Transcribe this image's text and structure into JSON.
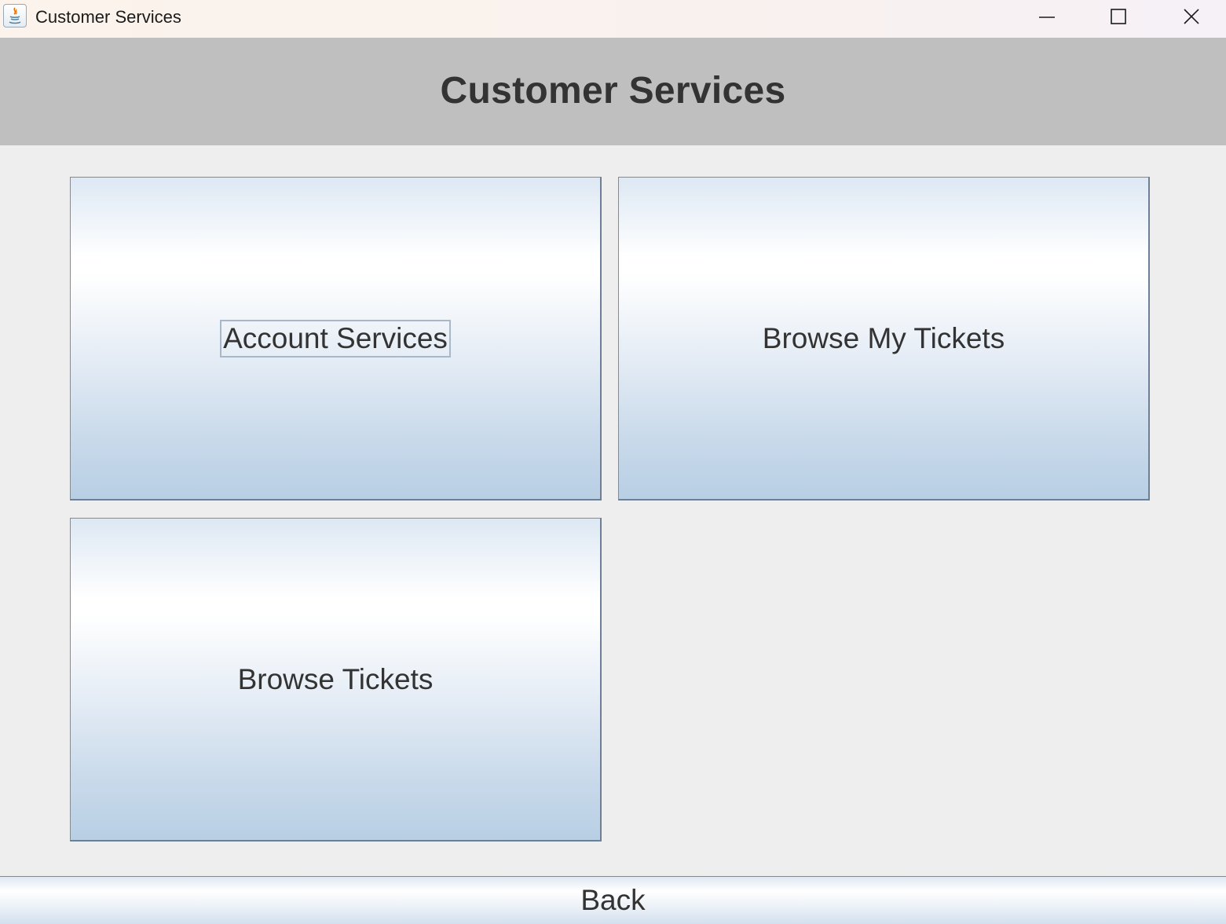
{
  "window": {
    "title": "Customer Services",
    "icon": "java-icon"
  },
  "header": {
    "title": "Customer Services"
  },
  "buttons": {
    "account_services": "Account Services",
    "browse_my_tickets": "Browse My Tickets",
    "browse_tickets": "Browse Tickets"
  },
  "footer": {
    "back_label": "Back"
  },
  "colors": {
    "header_bg": "#bfbfbf",
    "content_bg": "#eeeeee",
    "button_gradient_top": "#ffffff",
    "button_gradient_bottom": "#b8cfe4",
    "text": "#333333"
  }
}
